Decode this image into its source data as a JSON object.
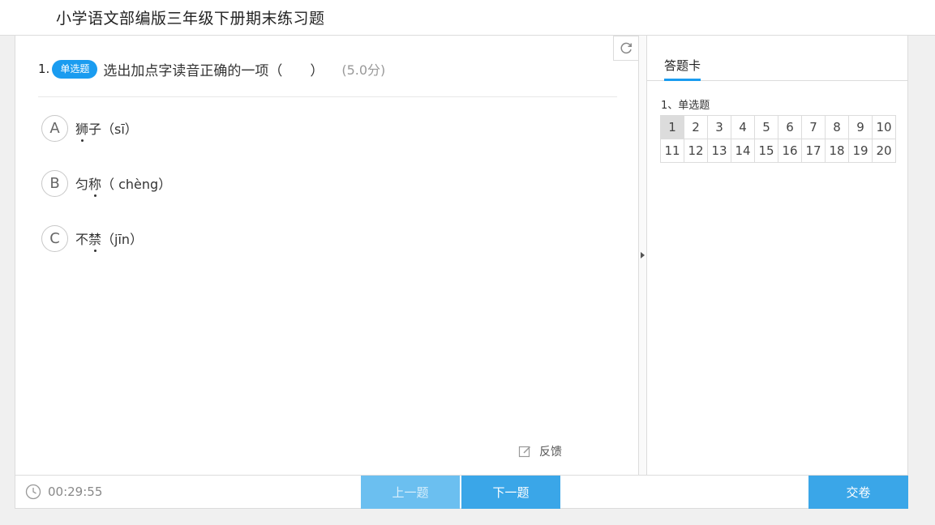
{
  "header": {
    "title": "小学语文部编版三年级下册期末练习题"
  },
  "question": {
    "number": "1.",
    "type_badge": "单选题",
    "text": "选出加点字读音正确的一项（　　）",
    "score": "(5.0分)",
    "options": [
      {
        "letter": "A",
        "pre": "",
        "dotted": "狮",
        "post": "子（sī）"
      },
      {
        "letter": "B",
        "pre": "匀",
        "dotted": "称",
        "post": "（ chèng）"
      },
      {
        "letter": "C",
        "pre": "不",
        "dotted": "禁",
        "post": "（jīn）"
      }
    ]
  },
  "feedback": {
    "label": "反馈"
  },
  "side": {
    "tab_label": "答题卡",
    "section_label": "1、单选题",
    "row1": [
      "1",
      "2",
      "3",
      "4",
      "5",
      "6",
      "7",
      "8",
      "9",
      "10"
    ],
    "row2": [
      "11",
      "12",
      "13",
      "14",
      "15",
      "16",
      "17",
      "18",
      "19",
      "20"
    ],
    "current": "1"
  },
  "footer": {
    "timer": "00:29:55",
    "prev_label": "上一题",
    "next_label": "下一题",
    "submit_label": "交卷"
  },
  "colors": {
    "accent": "#3aa6e8",
    "badge": "#1a9cf0",
    "current_cell": "#dcdcdc"
  }
}
